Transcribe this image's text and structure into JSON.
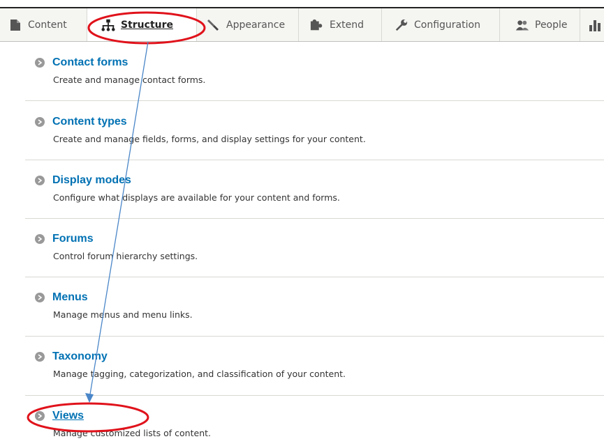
{
  "toolbar": {
    "tabs": [
      {
        "label": "Content",
        "icon": "page-icon"
      },
      {
        "label": "Structure",
        "icon": "sitemap-icon"
      },
      {
        "label": "Appearance",
        "icon": "paintbrush-icon"
      },
      {
        "label": "Extend",
        "icon": "puzzle-icon"
      },
      {
        "label": "Configuration",
        "icon": "wrench-icon"
      },
      {
        "label": "People",
        "icon": "people-icon"
      },
      {
        "label": "",
        "icon": "reports-icon"
      }
    ],
    "active": "Structure"
  },
  "items": [
    {
      "title": "Contact forms",
      "description": "Create and manage contact forms."
    },
    {
      "title": "Content types",
      "description": "Create and manage fields, forms, and display settings for your content."
    },
    {
      "title": "Display modes",
      "description": "Configure what displays are available for your content and forms."
    },
    {
      "title": "Forums",
      "description": "Control forum hierarchy settings."
    },
    {
      "title": "Menus",
      "description": "Manage menus and menu links."
    },
    {
      "title": "Taxonomy",
      "description": "Manage tagging, categorization, and classification of your content."
    },
    {
      "title": "Views",
      "description": "Manage customized lists of content."
    }
  ],
  "annotation": {
    "highlight_color": "#e0121b",
    "arrow_color": "#4a86c8"
  },
  "colors": {
    "link": "#0071b3",
    "toolbar_bg": "#f5f5f2"
  }
}
